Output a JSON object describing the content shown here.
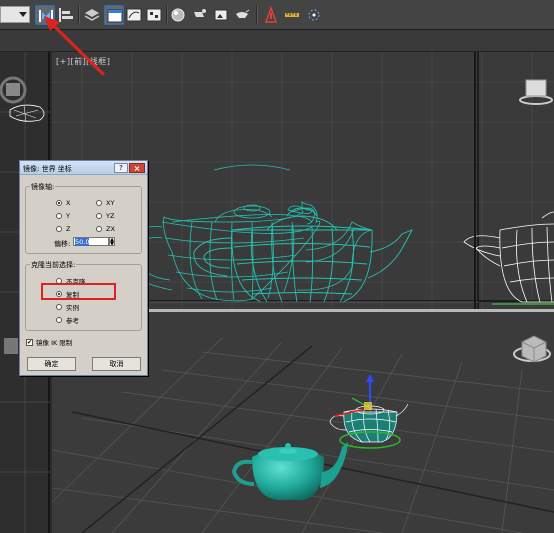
{
  "toolbar": {
    "buttons": [
      {
        "name": "mirror-icon",
        "active": true
      },
      {
        "name": "align-icon",
        "active": false
      },
      {
        "name": "layer-manager-icon",
        "active": false
      },
      {
        "name": "scene-explorer-icon",
        "active": true
      },
      {
        "name": "curve-editor-icon",
        "active": false
      },
      {
        "name": "schematic-view-icon",
        "active": false
      },
      {
        "name": "material-editor-icon",
        "active": false
      },
      {
        "name": "render-setup-icon",
        "active": false
      },
      {
        "name": "rendered-frame-icon",
        "active": false
      },
      {
        "name": "render-icon",
        "active": false
      },
      {
        "name": "stand-icon",
        "active": false
      },
      {
        "name": "ruler-icon",
        "active": false
      },
      {
        "name": "snaps-icon",
        "active": false
      }
    ]
  },
  "viewports": {
    "front_label": "[+][前][线框]"
  },
  "dialog": {
    "title": "镜像: 世界 坐标",
    "help_label": "?",
    "close_label": "×",
    "axis_group_label": "镜像轴:",
    "axes": [
      {
        "label": "X",
        "checked": true
      },
      {
        "label": "XY",
        "checked": false
      },
      {
        "label": "Y",
        "checked": false
      },
      {
        "label": "YZ",
        "checked": false
      },
      {
        "label": "Z",
        "checked": false
      },
      {
        "label": "ZX",
        "checked": false
      }
    ],
    "offset_label": "偏移:",
    "offset_value": "50.0",
    "clone_group_label": "克隆当前选择:",
    "clone_options": [
      {
        "label": "不克隆",
        "checked": false
      },
      {
        "label": "复制",
        "checked": true
      },
      {
        "label": "实例",
        "checked": false
      },
      {
        "label": "参考",
        "checked": false
      }
    ],
    "ik_checkbox_label": "镜像 IK 限制",
    "ik_checked": true,
    "ok_label": "确定",
    "cancel_label": "取消"
  },
  "colors": {
    "annotation": "#dd2222",
    "teapot_wire": "#23c4b4",
    "selection_wire": "#ffffff",
    "background": "#3a3a3a"
  }
}
